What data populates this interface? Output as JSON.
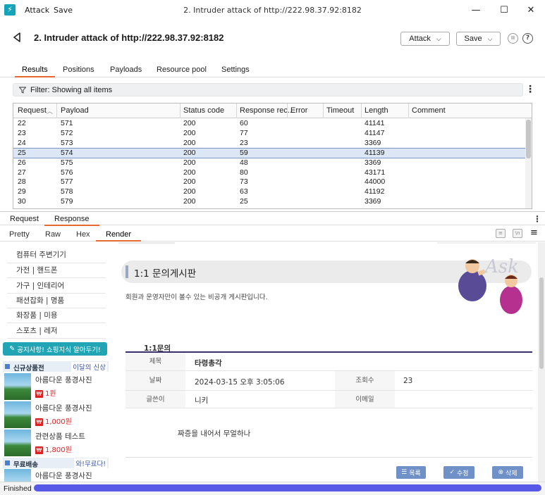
{
  "window": {
    "menu": [
      "Attack",
      "Save"
    ],
    "title": "2. Intruder attack of http://222.98.37.92:8182",
    "controls": [
      "minimize",
      "maximize",
      "close"
    ]
  },
  "header": {
    "title": "2. Intruder attack of http://222.98.37.92:8182",
    "attack_label": "Attack",
    "save_label": "Save",
    "pause_icon": "pause-icon",
    "help_icon": "help-icon"
  },
  "tabs": [
    "Results",
    "Positions",
    "Payloads",
    "Resource pool",
    "Settings"
  ],
  "filter": {
    "text": "Filter: Showing all items"
  },
  "table": {
    "columns": [
      "Request",
      "Payload",
      "Status code",
      "Response rec...",
      "Error",
      "Timeout",
      "Length",
      "Comment"
    ],
    "rows": [
      [
        "22",
        "571",
        "200",
        "60",
        "",
        "",
        "41141",
        ""
      ],
      [
        "23",
        "572",
        "200",
        "77",
        "",
        "",
        "41147",
        ""
      ],
      [
        "24",
        "573",
        "200",
        "23",
        "",
        "",
        "3369",
        ""
      ],
      [
        "25",
        "574",
        "200",
        "59",
        "",
        "",
        "41139",
        ""
      ],
      [
        "26",
        "575",
        "200",
        "48",
        "",
        "",
        "3369",
        ""
      ],
      [
        "27",
        "576",
        "200",
        "80",
        "",
        "",
        "43171",
        ""
      ],
      [
        "28",
        "577",
        "200",
        "73",
        "",
        "",
        "44000",
        ""
      ],
      [
        "29",
        "578",
        "200",
        "63",
        "",
        "",
        "41192",
        ""
      ],
      [
        "30",
        "579",
        "200",
        "25",
        "",
        "",
        "3369",
        ""
      ]
    ],
    "selected_request": "25"
  },
  "panel_tabs": [
    "Request",
    "Response"
  ],
  "view_tabs": [
    "Pretty",
    "Raw",
    "Hex",
    "Render"
  ],
  "render": {
    "sidebar_items": [
      "컴퓨터 주변기기",
      "가전 | 핸드폰",
      "가구 | 인테리어",
      "패션잡화 | 명품",
      "화장품 | 미용",
      "스포츠 | 레저"
    ],
    "notice_button": "공지사항! 쇼핑지식 알아두기!",
    "new_products": {
      "title": "신규상품전",
      "tag": "이달의 신상"
    },
    "products": [
      {
        "name": "아름다운 풍경사진",
        "price": "1원"
      },
      {
        "name": "아름다운 풍경사진",
        "price": "1,000원"
      },
      {
        "name": "관련상품 테스트",
        "price": "1,800원"
      }
    ],
    "free_shipping": {
      "title": "무료배송",
      "tag": "와!무료다!"
    },
    "last_product": "아름다운 풍경사진",
    "board_title": "1:1 문의게시판",
    "board_desc": "회원과 운영자만이 볼수 있는 비공개 게시판입니다.",
    "ask_text": "Ask",
    "inquiry_head": "1:1문의",
    "fields": {
      "subject_label": "제목",
      "subject": "타령총각",
      "date_label": "날짜",
      "date": "2024-03-15 오후 3:05:06",
      "views_label": "조회수",
      "views": "23",
      "author_label": "글쓴이",
      "author": "니키",
      "email_label": "이메일",
      "email": ""
    },
    "content": "짜증을 내어서 무얼하나",
    "buttons": [
      "목록",
      "수정",
      "삭제"
    ]
  },
  "status": {
    "text": "Finished",
    "progress": 1.0
  },
  "colors": {
    "accent": "#e8692f",
    "progress": "#5959e8",
    "selection": "#dde6f5",
    "teal": "#21a5b5"
  }
}
